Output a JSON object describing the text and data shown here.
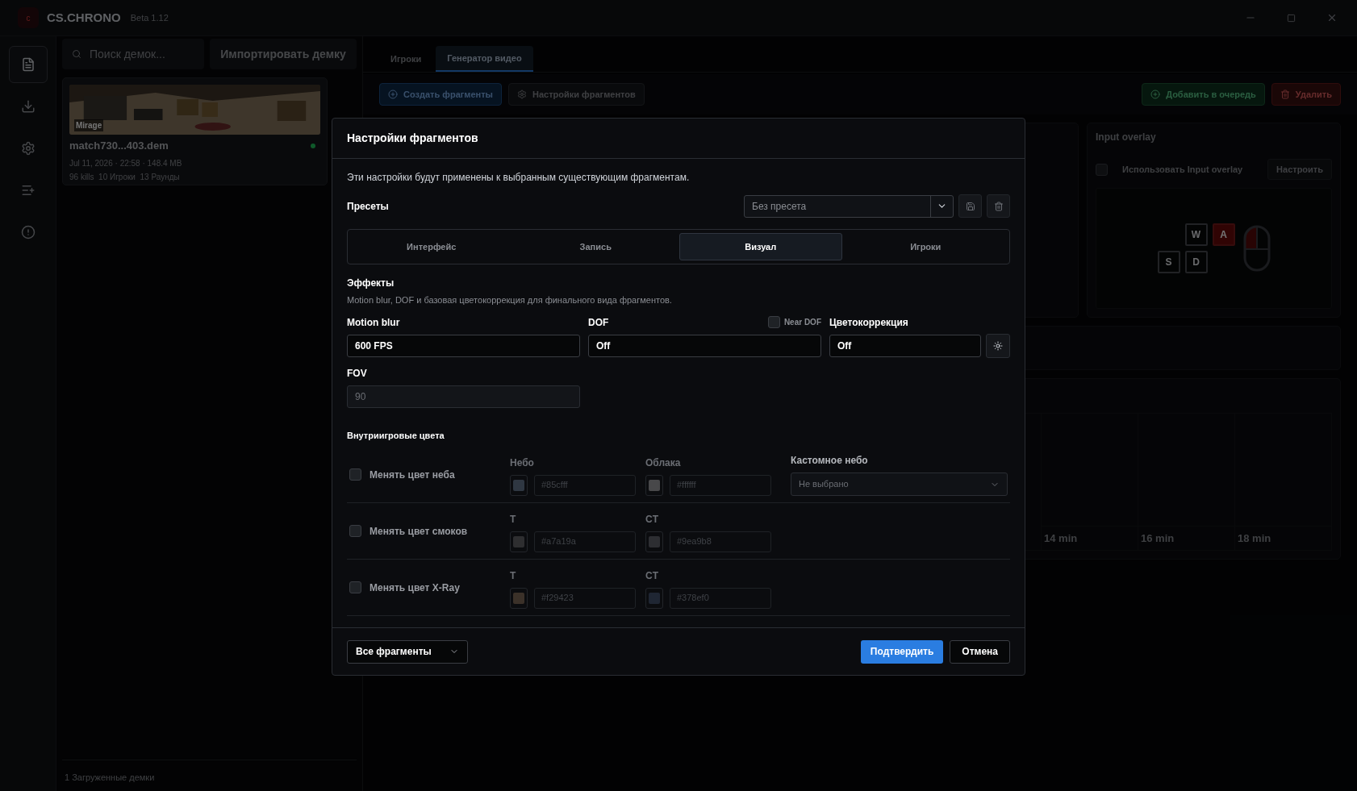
{
  "app": {
    "logo": "c",
    "title": "CS.CHRONO",
    "version": "Beta 1.12"
  },
  "sidebar": {
    "items": [
      {
        "selected": true
      },
      {
        "selected": false
      },
      {
        "selected": false
      },
      {
        "selected": false
      },
      {
        "selected": false
      }
    ]
  },
  "demos": {
    "search": {
      "placeholder": "Поиск демок..."
    },
    "import_button": "Импортировать демку",
    "items": [
      {
        "map": "Mirage",
        "name": "match730...403.dem",
        "meta": "Jul 11, 2026 · 22:58 · 148.4 MB",
        "stats": "96 kills  10 Игроки  13 Раунды"
      }
    ],
    "footer": "1 Загруженные демки"
  },
  "main": {
    "tabs": [
      {
        "label": "Игроки",
        "selected": false
      },
      {
        "label": "Генератор видео",
        "selected": true
      }
    ],
    "toolbar": [
      {
        "label": "Создать фрагменты",
        "kind": "primary"
      },
      {
        "label": "Настройки фрагментов",
        "kind": "secondary"
      },
      {
        "label": "Добавить в очередь",
        "kind": "success"
      },
      {
        "label": "Удалить",
        "kind": "danger"
      }
    ],
    "input_overlay": {
      "title": "Input overlay",
      "enabled": false,
      "label": "Использовать Input overlay",
      "button": "Настроить",
      "keys": [
        {
          "label": "W",
          "pressed": false
        },
        {
          "label": "A",
          "pressed": true
        },
        {
          "label": "S",
          "pressed": false
        },
        {
          "label": "D",
          "pressed": false
        }
      ],
      "mouse_left_pressed": true
    },
    "timeline": {
      "labels": [
        "14 min",
        "16 min",
        "18 min"
      ]
    }
  },
  "dialog": {
    "title": "Настройки фрагментов",
    "description": "Эти настройки будут применены к выбранным существующим фрагментам.",
    "presets": {
      "label": "Пресеты",
      "placeholder": "Без пресета"
    },
    "tabs": [
      {
        "label": "Интерфейс",
        "selected": false
      },
      {
        "label": "Запись",
        "selected": false
      },
      {
        "label": "Визуал",
        "selected": true
      },
      {
        "label": "Игроки",
        "selected": false
      }
    ],
    "effects": {
      "title": "Эффекты",
      "description": "Motion blur, DOF и базовая цветокоррекция для финального вида фрагментов.",
      "motion_blur": {
        "label": "Motion blur",
        "value": "600 FPS"
      },
      "dof": {
        "label": "DOF",
        "value": "Off",
        "near_label": "Near DOF",
        "near_checked": false
      },
      "color_correction": {
        "label": "Цветокоррекция",
        "value": "Off"
      },
      "fov": {
        "label": "FOV",
        "value": "90",
        "disabled": true
      }
    },
    "game_colors": {
      "title": "Внутриигровые цвета",
      "rows": [
        {
          "label": "Менять цвет неба",
          "checked": false,
          "colors": [
            {
              "label": "Небо",
              "placeholder": "#85cfff",
              "color": "#2f3742"
            },
            {
              "label": "Облака",
              "placeholder": "#ffffff",
              "color": "#48484a"
            }
          ],
          "custom": {
            "label": "Кастомное небо",
            "value": "Не выбрано"
          }
        },
        {
          "label": "Менять цвет смоков",
          "checked": false,
          "colors": [
            {
              "label": "T",
              "placeholder": "#a7a19a",
              "color": "#2e2e30"
            },
            {
              "label": "CT",
              "placeholder": "#9ea9b8",
              "color": "#2d2e32"
            }
          ]
        },
        {
          "label": "Менять цвет X-Ray",
          "checked": false,
          "colors": [
            {
              "label": "T",
              "placeholder": "#f29423",
              "color": "#3b3129"
            },
            {
              "label": "CT",
              "placeholder": "#378ef0",
              "color": "#1f2633"
            }
          ]
        }
      ]
    },
    "scope": "Все фрагменты",
    "confirm": "Подтвердить",
    "cancel": "Отмена"
  }
}
